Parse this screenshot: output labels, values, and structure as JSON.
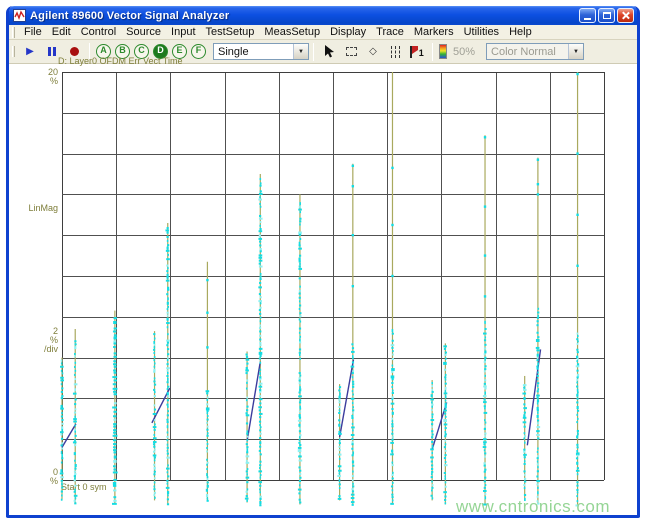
{
  "window": {
    "title": "Agilent 89600 Vector Signal Analyzer"
  },
  "icons": {
    "close": "×",
    "play": "▶",
    "dropdown": "▼",
    "diamond": "◇"
  },
  "menu": {
    "items": [
      {
        "label": "File"
      },
      {
        "label": "Edit"
      },
      {
        "label": "Control"
      },
      {
        "label": "Source"
      },
      {
        "label": "Input"
      },
      {
        "label": "TestSetup"
      },
      {
        "label": "MeasSetup"
      },
      {
        "label": "Display"
      },
      {
        "label": "Trace"
      },
      {
        "label": "Markers"
      },
      {
        "label": "Utilities"
      },
      {
        "label": "Help"
      }
    ]
  },
  "toolbar": {
    "trace_buttons": [
      {
        "label": "A",
        "selected": false
      },
      {
        "label": "B",
        "selected": false
      },
      {
        "label": "C",
        "selected": false
      },
      {
        "label": "D",
        "selected": true
      },
      {
        "label": "E",
        "selected": false
      },
      {
        "label": "F",
        "selected": false
      }
    ],
    "sweep_mode": {
      "value": "Single"
    },
    "marker_number": "1",
    "zoom_level": "50%",
    "color_mode": {
      "value": "Color Normal"
    }
  },
  "chart": {
    "title": "D: Layer0 OFDM Err Vect Time",
    "y_max": "20",
    "y_unit": "%",
    "scale_label": "LinMag",
    "div_value": "2",
    "div_unit": "%",
    "div_suffix": "/div",
    "y_min": "0",
    "y_min_unit": "%",
    "x_start_label": "Start 0 sym"
  },
  "watermark": "www.cntronics.com",
  "chart_data": {
    "type": "scatter",
    "title": "D: Layer0 OFDM Err Vect Time",
    "x_axis": {
      "label": "sym",
      "start": 0,
      "approx_total_sym": 41
    },
    "y_axis": {
      "label": "LinMag",
      "unit": "%",
      "min": 0,
      "max": 20,
      "per_div": 2
    },
    "grid": {
      "cols": 10,
      "rows": 10,
      "on": true,
      "color": "#505050",
      "border_color": "#3e3e3e"
    },
    "colors": {
      "dots": "#12dde4",
      "dots_alt": "#8af2f4",
      "spikes": "#a9a95e",
      "segments": "#3c3c9d"
    },
    "columns": [
      {
        "sym": 0,
        "spike_top_pct": 6.0,
        "dense_top_pct": 5.9,
        "dense_bottom_pct": -1.0
      },
      {
        "sym": 1,
        "spike_top_pct": 7.4,
        "dense_top_pct": 7.0,
        "dense_bottom_pct": -1.1
      },
      {
        "sym": 4,
        "spike_top_pct": 8.3,
        "dense_top_pct": 8.2,
        "dense_bottom_pct": -1.2,
        "wide": true
      },
      {
        "sym": 7,
        "spike_top_pct": 7.3,
        "dense_top_pct": 7.2,
        "dense_bottom_pct": -1.0
      },
      {
        "sym": 8,
        "spike_top_pct": 12.6,
        "dense_top_pct": 12.4,
        "dense_bottom_pct": -1.2
      },
      {
        "sym": 11,
        "spike_top_pct": 10.7,
        "dense_top_pct": 4.4,
        "dense_bottom_pct": -1.0,
        "sparse_pcts": [
          9.8,
          8.2,
          6.5
        ]
      },
      {
        "sym": 14,
        "spike_top_pct": 6.3,
        "dense_top_pct": 6.2,
        "dense_bottom_pct": -1.1
      },
      {
        "sym": 15,
        "spike_top_pct": 15.0,
        "dense_top_pct": 14.8,
        "dense_bottom_pct": -1.2
      },
      {
        "sym": 18,
        "spike_top_pct": 14.0,
        "dense_top_pct": 13.8,
        "dense_bottom_pct": -1.2
      },
      {
        "sym": 21,
        "spike_top_pct": 4.7,
        "dense_top_pct": 4.6,
        "dense_bottom_pct": -1.0
      },
      {
        "sym": 22,
        "spike_top_pct": 15.5,
        "dense_top_pct": 6.7,
        "dense_bottom_pct": -1.2,
        "sparse_pcts": [
          15.4,
          14.4,
          12.0,
          9.5
        ]
      },
      {
        "sym": 25,
        "spike_top_pct": 20.0,
        "dense_top_pct": 7.4,
        "dense_bottom_pct": -1.2,
        "sparse_pcts": [
          15.3,
          12.5,
          10.0
        ]
      },
      {
        "sym": 28,
        "spike_top_pct": 4.9,
        "dense_top_pct": 4.8,
        "dense_bottom_pct": -1.0
      },
      {
        "sym": 29,
        "spike_top_pct": 6.7,
        "dense_top_pct": 6.6,
        "dense_bottom_pct": -1.2
      },
      {
        "sym": 32,
        "spike_top_pct": 16.9,
        "dense_top_pct": 7.8,
        "dense_bottom_pct": -1.2,
        "sparse_pcts": [
          16.8,
          13.4,
          11.0,
          9.0
        ]
      },
      {
        "sym": 35,
        "spike_top_pct": 5.1,
        "dense_top_pct": 4.7,
        "dense_bottom_pct": -1.0
      },
      {
        "sym": 36,
        "spike_top_pct": 15.8,
        "dense_top_pct": 8.6,
        "dense_bottom_pct": -1.2,
        "sparse_pcts": [
          15.7,
          14.5,
          14.0
        ]
      },
      {
        "sym": 39,
        "spike_top_pct": 20.0,
        "dense_top_pct": 7.4,
        "dense_bottom_pct": -1.2,
        "sparse_pcts": [
          19.9,
          16.0,
          13.0,
          10.5
        ]
      }
    ],
    "segments": [
      {
        "x1_sym": 0.0,
        "y1_pct": 1.6,
        "x2_sym": 1.05,
        "y2_pct": 2.75
      },
      {
        "x1_sym": 6.8,
        "y1_pct": 2.8,
        "x2_sym": 8.15,
        "y2_pct": 4.5
      },
      {
        "x1_sym": 14.0,
        "y1_pct": 1.9,
        "x2_sym": 15.0,
        "y2_pct": 5.8
      },
      {
        "x1_sym": 21.0,
        "y1_pct": 2.1,
        "x2_sym": 22.05,
        "y2_pct": 5.9
      },
      {
        "x1_sym": 28.0,
        "y1_pct": 1.5,
        "x2_sym": 29.1,
        "y2_pct": 3.8
      },
      {
        "x1_sym": 35.2,
        "y1_pct": 1.7,
        "x2_sym": 36.2,
        "y2_pct": 6.4
      }
    ]
  }
}
